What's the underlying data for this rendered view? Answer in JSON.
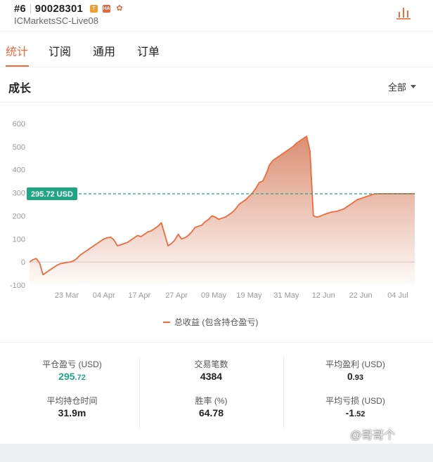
{
  "header": {
    "rank": "#6",
    "account_id": "90028301",
    "badges": [
      "T",
      "HA",
      "fox-icon"
    ],
    "server": "ICMarketsSC-Live08",
    "chart_icon": "bar-chart-icon"
  },
  "tabs": [
    {
      "label": "统计",
      "active": true
    },
    {
      "label": "订阅",
      "active": false
    },
    {
      "label": "通用",
      "active": false
    },
    {
      "label": "订单",
      "active": false
    }
  ],
  "section": {
    "title": "成长",
    "filter_label": "全部"
  },
  "chart_data": {
    "type": "area",
    "title": "",
    "xlabel": "",
    "ylabel": "",
    "ylim": [
      -100,
      600
    ],
    "yticks": [
      -100,
      0,
      100,
      200,
      300,
      400,
      500,
      600
    ],
    "xtick_labels": [
      "23 Mar",
      "04 Apr",
      "17 Apr",
      "27 Apr",
      "09 May",
      "19 May",
      "31 May",
      "12 Jun",
      "22 Jun",
      "04 Jul"
    ],
    "x_domain": [
      0,
      100
    ],
    "xtick_positions": [
      11,
      22,
      32.5,
      43.5,
      54.5,
      65,
      76,
      87,
      98,
      109
    ],
    "current_value": 295.72,
    "current_label": "295.72 USD",
    "grid": false,
    "colors": {
      "line": "#ee6b3b",
      "fill": "#d9896b",
      "marker": "#1ea685",
      "axis_text": "#999999"
    },
    "series": [
      {
        "name": "总收益 (包含持仓盈亏)",
        "x": [
          0,
          1,
          2,
          3,
          4,
          5,
          6,
          7,
          8,
          9,
          10,
          11,
          12,
          13,
          14,
          15,
          16,
          17,
          18,
          19,
          20,
          21,
          22,
          23,
          24,
          25,
          26,
          27,
          28,
          29,
          30,
          31,
          32,
          33,
          34,
          35,
          36,
          37,
          38,
          39,
          40,
          41,
          42,
          43,
          44,
          45,
          46,
          47,
          48,
          49,
          50,
          51,
          52,
          53,
          54,
          55,
          56,
          57,
          58,
          59,
          60,
          61,
          62,
          63,
          64,
          65,
          66,
          67,
          68,
          69,
          70,
          71,
          72,
          73,
          74,
          75,
          76,
          77,
          78,
          79,
          80,
          81,
          82,
          83,
          84,
          85,
          86,
          87,
          88,
          89,
          90,
          91,
          92,
          93,
          94,
          95,
          96,
          97,
          98,
          99,
          100,
          101,
          102,
          103,
          104,
          105,
          106,
          107,
          108,
          109,
          110,
          111,
          112,
          113,
          114
        ],
        "values": [
          0,
          10,
          15,
          -5,
          -55,
          -45,
          -35,
          -25,
          -15,
          -8,
          -5,
          -2,
          0,
          5,
          15,
          30,
          40,
          50,
          60,
          70,
          80,
          90,
          100,
          105,
          108,
          95,
          70,
          75,
          80,
          85,
          95,
          105,
          115,
          110,
          120,
          130,
          135,
          145,
          155,
          170,
          120,
          70,
          80,
          95,
          120,
          100,
          105,
          115,
          130,
          150,
          155,
          160,
          175,
          185,
          200,
          195,
          185,
          190,
          195,
          205,
          215,
          230,
          250,
          260,
          270,
          285,
          300,
          320,
          345,
          350,
          380,
          420,
          440,
          450,
          460,
          470,
          480,
          490,
          500,
          515,
          525,
          535,
          545,
          480,
          200,
          195,
          198,
          205,
          210,
          215,
          218,
          220,
          225,
          230,
          240,
          250,
          260,
          270,
          275,
          280,
          285,
          290,
          295,
          295.72,
          296,
          296,
          296,
          296,
          296,
          296,
          296,
          296,
          296,
          296,
          296
        ]
      }
    ],
    "legend_position": "bottom-center"
  },
  "stats": [
    {
      "label": "平仓盈亏 (USD)",
      "int": "295",
      "dec": ".72",
      "highlight": true
    },
    {
      "label": "交易笔数",
      "int": "4384",
      "dec": "",
      "highlight": false
    },
    {
      "label": "平均盈利 (USD)",
      "int": "0",
      "dec": ".93",
      "highlight": false
    },
    {
      "label": "平均持仓时间",
      "int": "31.9m",
      "dec": "",
      "highlight": false
    },
    {
      "label": "胜率 (%)",
      "int": "64.78",
      "dec": "",
      "highlight": false
    },
    {
      "label": "平均亏损 (USD)",
      "int": "-1",
      "dec": ".52",
      "highlight": false
    }
  ],
  "watermark": "@哥哥个"
}
